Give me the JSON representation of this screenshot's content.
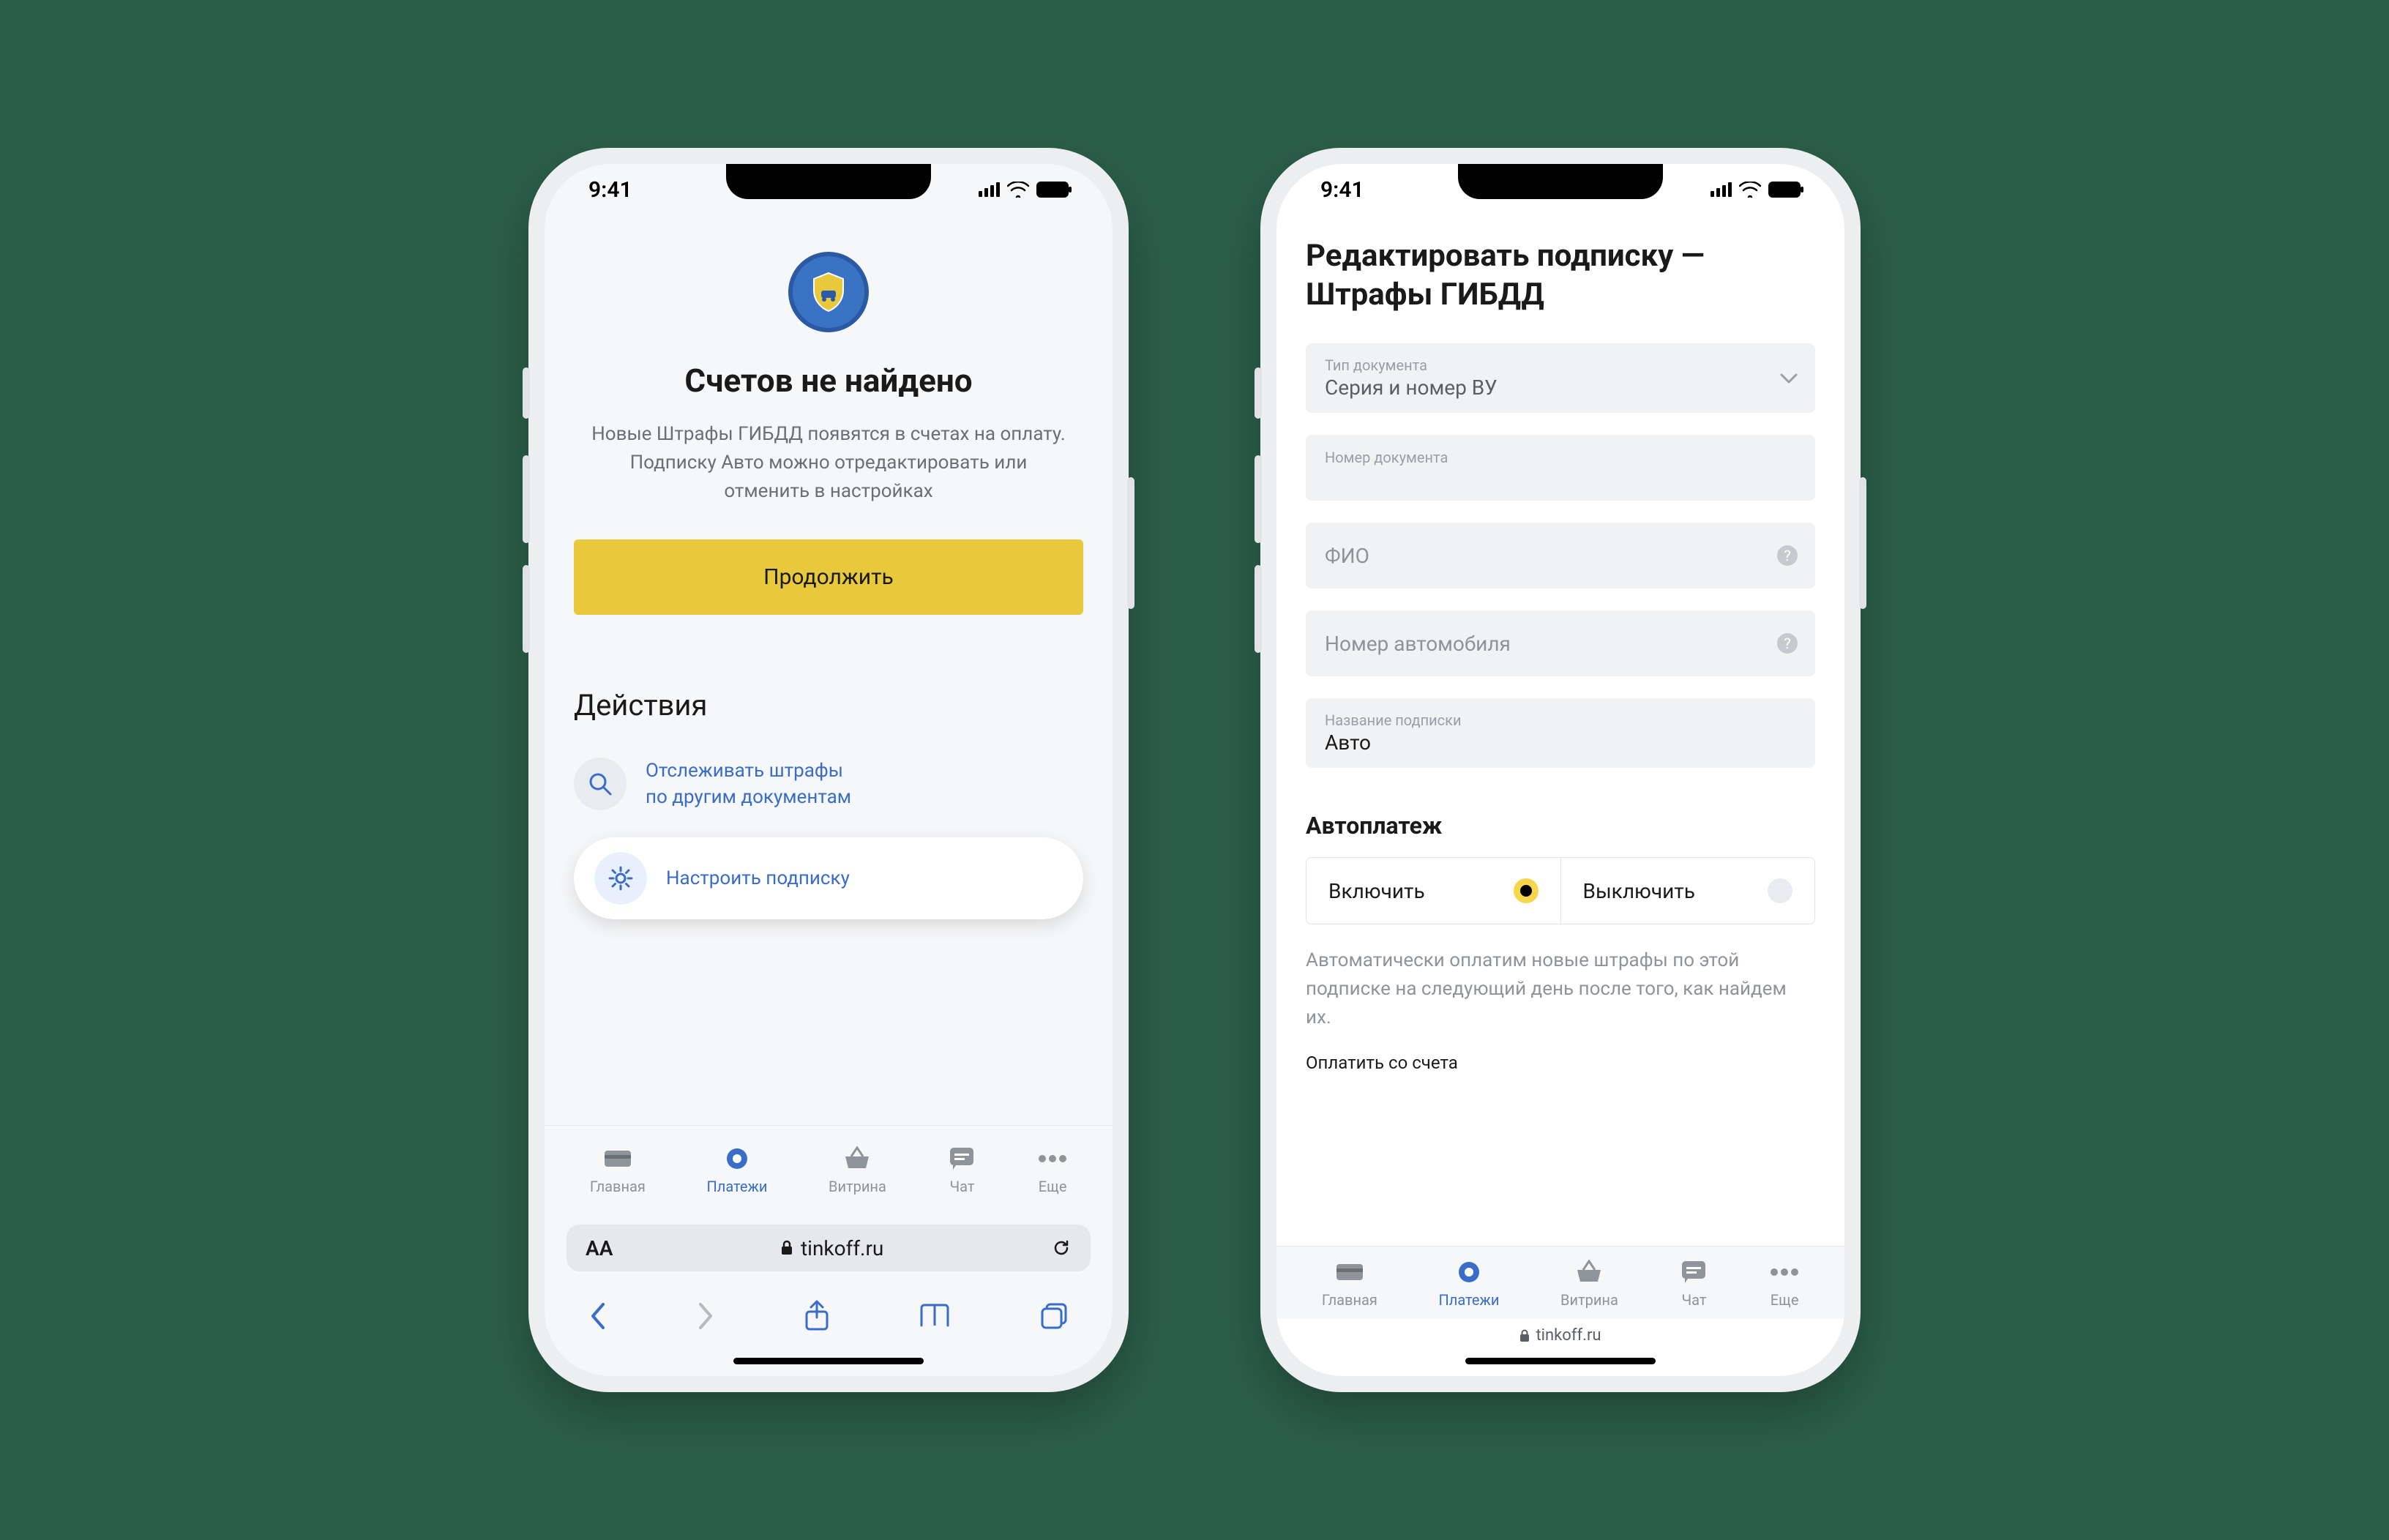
{
  "status": {
    "time": "9:41"
  },
  "left": {
    "hero_title": "Счетов не найдено",
    "hero_text": "Новые Штрафы ГИБДД появятся в счетах на оплату. Подписку Авто можно отредактировать или отменить в настройках",
    "primary": "Продолжить",
    "section": "Действия",
    "action1_line1": "Отслеживать штрафы",
    "action1_line2": "по другим документам",
    "action2": "Настроить подписку",
    "url_aA": "AA",
    "url_domain": "tinkoff.ru"
  },
  "right": {
    "title": "Редактировать подписку — Штрафы ГИБДД",
    "doc_type_label": "Тип документа",
    "doc_type_value": "Серия и номер ВУ",
    "doc_num_label": "Номер документа",
    "fio": "ФИО",
    "car_num": "Номер автомобиля",
    "sub_name_label": "Название подписки",
    "sub_name_value": "Авто",
    "autopay": "Автоплатеж",
    "on": "Включить",
    "off": "Выключить",
    "note": "Автоматически оплатим новые штрафы по этой подписке на следующий день после того, как найдем их.",
    "pay_from": "Оплатить со счета",
    "url_domain": "tinkoff.ru"
  },
  "tabs": {
    "home": "Главная",
    "payments": "Платежи",
    "showcase": "Витрина",
    "chat": "Чат",
    "more": "Еще"
  }
}
